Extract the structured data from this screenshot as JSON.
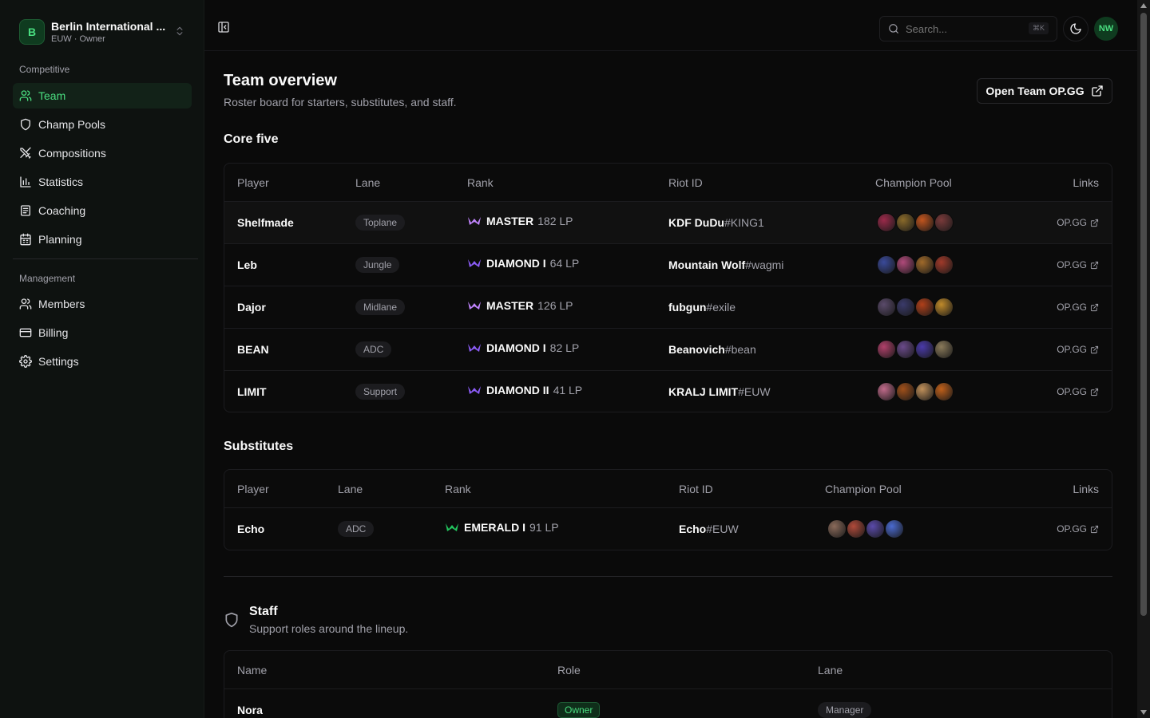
{
  "sidebar": {
    "team": {
      "initial": "B",
      "name": "Berlin International ...",
      "sub": "EUW · Owner"
    },
    "groups": {
      "competitive": "Competitive",
      "management": "Management"
    },
    "competitive_items": [
      {
        "label": "Team",
        "icon": "users-icon"
      },
      {
        "label": "Champ Pools",
        "icon": "shield-icon"
      },
      {
        "label": "Compositions",
        "icon": "swords-icon"
      },
      {
        "label": "Statistics",
        "icon": "bar-chart-icon"
      },
      {
        "label": "Coaching",
        "icon": "notebook-icon"
      },
      {
        "label": "Planning",
        "icon": "calendar-icon"
      }
    ],
    "management_items": [
      {
        "label": "Members",
        "icon": "users-icon"
      },
      {
        "label": "Billing",
        "icon": "credit-card-icon"
      },
      {
        "label": "Settings",
        "icon": "gear-icon"
      }
    ]
  },
  "topbar": {
    "search_placeholder": "Search...",
    "shortcut": "⌘K",
    "avatar": "NW"
  },
  "colors": {
    "accent": "#4ade80",
    "master": "#c084fc",
    "diamond": "#8b5cf6",
    "emerald": "#22c55e"
  },
  "page": {
    "title": "Team overview",
    "subtitle": "Roster board for starters, substitutes, and staff.",
    "opgg_button": "Open Team OP.GG"
  },
  "core": {
    "title": "Core five",
    "headers": {
      "player": "Player",
      "lane": "Lane",
      "rank": "Rank",
      "riot": "Riot ID",
      "pool": "Champion Pool",
      "links": "Links"
    },
    "rows": [
      {
        "player": "Shelfmade",
        "lane": "Toplane",
        "tier": "MASTER",
        "lp": "182 LP",
        "riot_name": "KDF DuDu",
        "riot_tag": "#KING1",
        "link": "OP.GG",
        "champs": [
          "#9b2a4a",
          "#8a6a2a",
          "#c2551e",
          "#7a3a3a"
        ]
      },
      {
        "player": "Leb",
        "lane": "Jungle",
        "tier": "DIAMOND I",
        "lp": "64 LP",
        "riot_name": "Mountain Wolf",
        "riot_tag": "#wagmi",
        "link": "OP.GG",
        "champs": [
          "#3a4a9a",
          "#b04a7a",
          "#a06a2a",
          "#a03a2a"
        ]
      },
      {
        "player": "Dajor",
        "lane": "Midlane",
        "tier": "MASTER",
        "lp": "126 LP",
        "riot_name": "fubgun",
        "riot_tag": "#exile",
        "link": "OP.GG",
        "champs": [
          "#5a4a6a",
          "#3a3a6a",
          "#b0401a",
          "#c08a2a"
        ]
      },
      {
        "player": "BEAN",
        "lane": "ADC",
        "tier": "DIAMOND I",
        "lp": "82 LP",
        "riot_name": "Beanovich",
        "riot_tag": "#bean",
        "link": "OP.GG",
        "champs": [
          "#b0406a",
          "#6a4a8a",
          "#4a3aaa",
          "#8a7a5a"
        ]
      },
      {
        "player": "LIMIT",
        "lane": "Support",
        "tier": "DIAMOND II",
        "lp": "41 LP",
        "riot_name": "KRALJ LIMIT",
        "riot_tag": "#EUW",
        "link": "OP.GG",
        "champs": [
          "#c06a8a",
          "#a0501a",
          "#c0905a",
          "#c0601a"
        ]
      }
    ]
  },
  "subs": {
    "title": "Substitutes",
    "headers": {
      "player": "Player",
      "lane": "Lane",
      "rank": "Rank",
      "riot": "Riot ID",
      "pool": "Champion Pool",
      "links": "Links"
    },
    "rows": [
      {
        "player": "Echo",
        "lane": "ADC",
        "tier": "EMERALD I",
        "lp": "91 LP",
        "riot_name": "Echo",
        "riot_tag": "#EUW",
        "link": "OP.GG",
        "champs": [
          "#8a6a5a",
          "#b04a3a",
          "#5a4aaa",
          "#4a6ad0"
        ]
      }
    ]
  },
  "staff": {
    "title": "Staff",
    "subtitle": "Support roles around the lineup.",
    "headers": {
      "name": "Name",
      "role": "Role",
      "lane": "Lane"
    },
    "rows": [
      {
        "name": "Nora",
        "role": "Owner",
        "lane": "Manager"
      }
    ]
  }
}
